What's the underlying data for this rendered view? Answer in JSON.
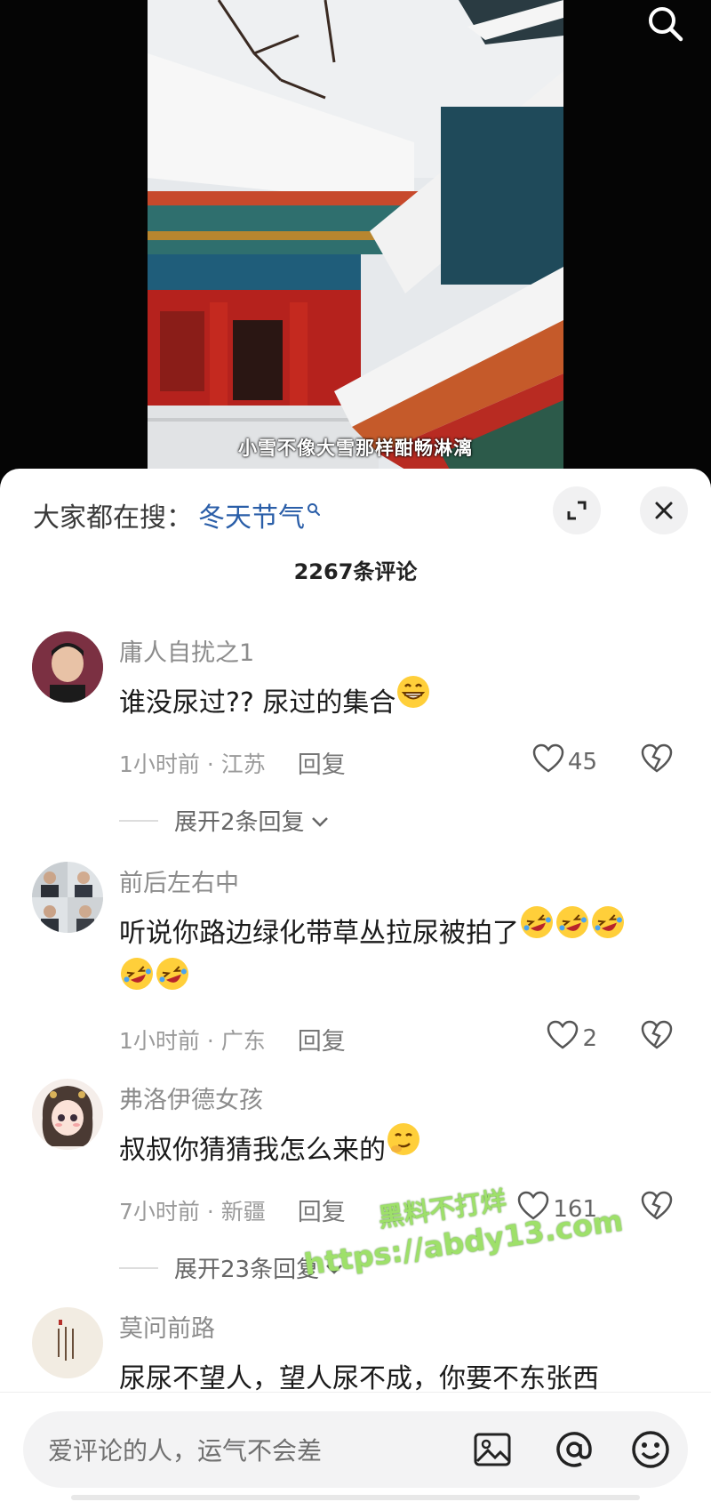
{
  "video": {
    "subtitle": "小雪不像大雪那样酣畅淋漓",
    "search_icon": "search-icon"
  },
  "header": {
    "trending_prefix": "大家都在搜：",
    "trending_keyword": "冬天节气",
    "expand_icon": "expand-icon",
    "close_icon": "close-icon"
  },
  "comment_count": "2267条评论",
  "comments": [
    {
      "author": "庸人自扰之1",
      "text": "谁没尿过?? 尿过的集合",
      "time_location": "1小时前 · 江苏",
      "reply": "回复",
      "likes": "45",
      "expand": "展开2条回复"
    },
    {
      "author": "前后左右中",
      "text_line1": "听说你路边绿化带草丛拉尿被拍了",
      "time_location": "1小时前 · 广东",
      "reply": "回复",
      "likes": "2"
    },
    {
      "author": "弗洛伊德女孩",
      "text": "叔叔你猜猜我怎么来的",
      "time_location": "7小时前 · 新疆",
      "reply": "回复",
      "likes": "161",
      "expand": "展开23条回复"
    },
    {
      "author": "莫问前路",
      "text": "尿尿不望人，望人尿不成，你要不东张西"
    }
  ],
  "watermark": {
    "line1": "黑料不打烊",
    "line2": "https://abdy13.com"
  },
  "input": {
    "placeholder": "爱评论的人，运气不会差"
  },
  "colors": {
    "keyword": "#2a5ea8",
    "watermark": "#9ee06a",
    "background": "#ffffff"
  }
}
